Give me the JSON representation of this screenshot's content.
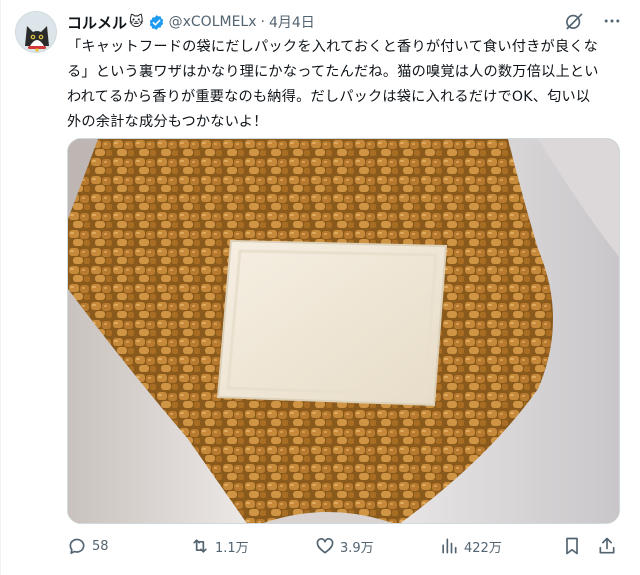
{
  "post": {
    "author": {
      "display_name": "コルメル",
      "emoji": "🐱",
      "handle": "@xCOLMELx",
      "separator": "·",
      "date": "4月4日"
    },
    "text_lines": [
      "「キャットフードの袋にだしパックを入れておくと香りが付いて食い付きが良くな",
      "る」という裏ワザはかなり理にかなってたんだね。猫の嗅覚は人の数万倍以上とい",
      "われてるから香りが重要なのも納得。だしパックは袋に入れるだけでOK、匂い以",
      "外の余計な成分もつかないよ！"
    ],
    "metrics": {
      "replies": "58",
      "reposts": "1.1万",
      "likes": "3.9万",
      "views": "422万"
    }
  },
  "icons": [
    "avatar",
    "verified-badge-icon",
    "grok-icon",
    "more-icon",
    "reply-icon",
    "repost-icon",
    "like-icon",
    "views-icon",
    "bookmark-icon",
    "share-icon"
  ],
  "colors": {
    "text": "#0f1419",
    "secondary": "#536471",
    "verified": "#1d9bf0"
  }
}
